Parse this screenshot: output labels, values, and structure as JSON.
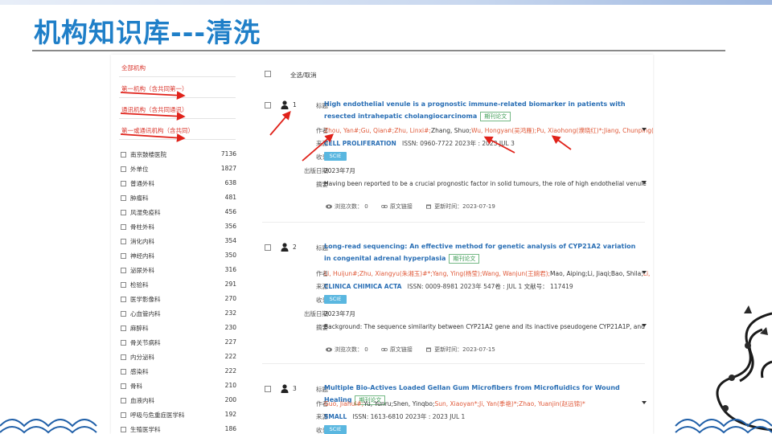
{
  "slide": {
    "title": "机构知识库---清洗"
  },
  "sidebar": {
    "all_label": "全部机构",
    "links": [
      "第一机构（含共同第一）",
      "通讯机构（含共同通讯）",
      "第一或通讯机构（含共同）"
    ],
    "facets": [
      {
        "label": "南京鼓楼医院",
        "count": "7136"
      },
      {
        "label": "外单位",
        "count": "1827"
      },
      {
        "label": "普通外科",
        "count": "638"
      },
      {
        "label": "肿瘤科",
        "count": "481"
      },
      {
        "label": "风湿免疫科",
        "count": "456"
      },
      {
        "label": "骨柱外科",
        "count": "356"
      },
      {
        "label": "消化内科",
        "count": "354"
      },
      {
        "label": "神经内科",
        "count": "350"
      },
      {
        "label": "泌尿外科",
        "count": "316"
      },
      {
        "label": "检验科",
        "count": "291"
      },
      {
        "label": "医学影像科",
        "count": "270"
      },
      {
        "label": "心血管内科",
        "count": "232"
      },
      {
        "label": "麻醉科",
        "count": "230"
      },
      {
        "label": "骨关节病科",
        "count": "227"
      },
      {
        "label": "内分泌科",
        "count": "222"
      },
      {
        "label": "感染科",
        "count": "222"
      },
      {
        "label": "骨科",
        "count": "210"
      },
      {
        "label": "血液内科",
        "count": "200"
      },
      {
        "label": "呼吸与危重症医学科",
        "count": "192"
      },
      {
        "label": "生殖医学科",
        "count": "186"
      }
    ]
  },
  "results": {
    "select_all": "全选/取消",
    "labels": {
      "title": "标题",
      "author": "作者",
      "source": "来源",
      "indexed": "收录",
      "pubdate": "出版日期",
      "abstract": "摘要"
    },
    "records": [
      {
        "num": "1",
        "title": "High endothelial venule is a prognostic immune-related biomarker in patients with resected intrahepatic cholangiocarcinoma",
        "tag": "期刊论文",
        "authors_red1": "Zhou, Yan#;Gu, Qian#;Zhu, Linxi#;",
        "authors_blk": "Zhang, Shuo;",
        "authors_red2": "Wu, Hongyan(吴鸿雁);Pu, Xiaohong(濮晓红)*;Jiang, Chunping(江",
        "journal": "CELL PROLIFERATION",
        "source_rest": "ISSN: 0960-7722   2023年 : 2023 JUL 3",
        "index": "SCIE",
        "pubdate": "2023年7月",
        "abstract": "Having been reported to be a crucial prognostic factor in solid tumours, the role of high endothelial venule",
        "views": "浏览次数： 0",
        "fulltext": "原文链接",
        "updated": "更新时间：2023-07-19"
      },
      {
        "num": "2",
        "title": "Long-read sequencing: An effective method for genetic analysis of CYP21A2 variation in congenital adrenal hyperplasia",
        "tag": "期刊论文",
        "authors_red1": "Li, Huijun#;Zhu, Xiangyu(朱湘玉)#*;Yang, Ying(杨莹);Wang, Wanjun(王婉君);",
        "authors_blk": "Mao, Aiping;Li, Jiaqi;Bao, Shila;",
        "authors_red2": "Li,",
        "journal": "CLINICA CHIMICA ACTA",
        "source_rest": "ISSN: 0009-8981   2023年 547卷 : JUL 1   文献号： 117419",
        "index": "SCIE",
        "pubdate": "2023年7月",
        "abstract": "Background: The sequence similarity between CYP21A2 gene and its inactive pseudogene CYP21A1P, and",
        "views": "浏览次数： 0",
        "fulltext": "原文链接",
        "updated": "更新时间：2023-07-15"
      },
      {
        "num": "3",
        "title": "Multiple Bio-Actives Loaded Gellan Gum Microfibers from Microfluidics for Wound Healing",
        "tag": "期刊论文",
        "authors_red1": "Guo, Jiahui#;",
        "authors_blk": "Yu, Yunru;Shen, Yinqbo;",
        "authors_red2": "Sun, Xiaoyan*;Ji, Yan(季艳)*;Zhao, Yuanjin(赵远锦)*",
        "journal": "SMALL",
        "source_rest": "ISSN: 1613-6810   2023年 : 2023 JUL 1",
        "index": "SCIE"
      }
    ]
  },
  "colors": {
    "title_blue": "#1f7fc8",
    "link_blue": "#2a6fb5",
    "author_red": "#e05a3a",
    "tag_green": "#3a9a52",
    "badge_blue": "#5ab7e0",
    "arrow_red": "#e0221a"
  }
}
